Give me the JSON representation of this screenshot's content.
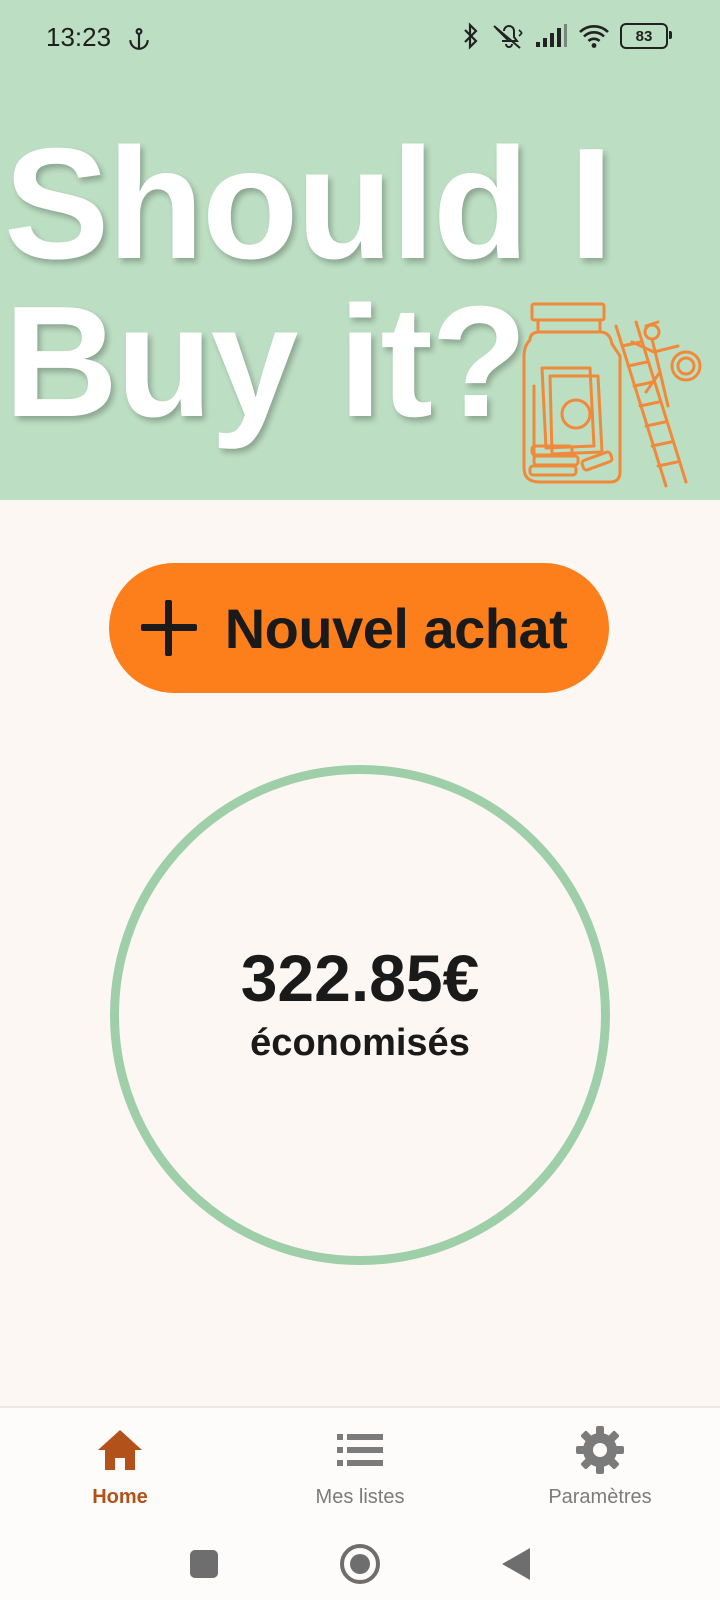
{
  "status_bar": {
    "time": "13:23",
    "battery": "83",
    "icons": [
      "anchor-icon",
      "bluetooth-icon",
      "vibrate-off-icon",
      "signal-icon",
      "wifi-icon",
      "battery-icon"
    ]
  },
  "header": {
    "title_line1": "Should I",
    "title_line2": "Buy it?",
    "background": "#bcdec2",
    "illustration": "jar-ladder-illustration"
  },
  "main": {
    "new_purchase_label": "Nouvel achat",
    "new_purchase_icon": "plus-icon",
    "accent_color": "#fd7f1b",
    "savings_amount": "322.85€",
    "savings_label": "économisés",
    "circle_color": "#9fcfa8"
  },
  "bottom_nav": {
    "items": [
      {
        "label": "Home",
        "icon": "home-icon",
        "active": true
      },
      {
        "label": "Mes listes",
        "icon": "list-icon",
        "active": false
      },
      {
        "label": "Paramètres",
        "icon": "gear-icon",
        "active": false
      }
    ],
    "active_color": "#b2521a"
  },
  "system_nav": {
    "buttons": [
      "recents-icon",
      "home-circle-icon",
      "back-icon"
    ]
  }
}
